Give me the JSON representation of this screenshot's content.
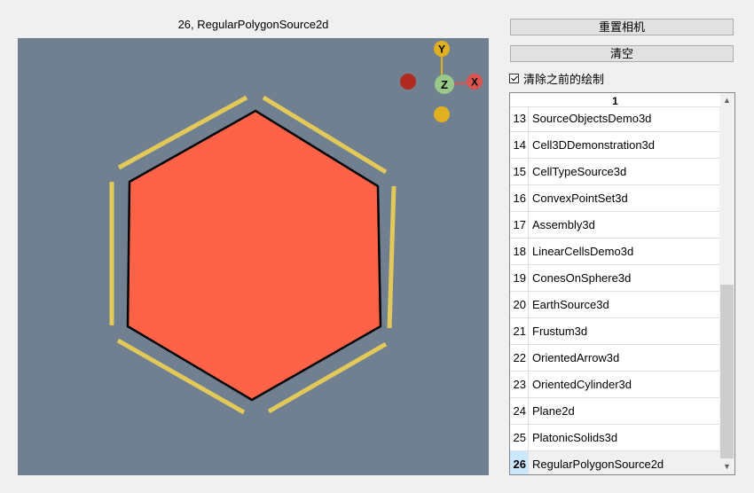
{
  "window": {
    "title": "26, RegularPolygonSource2d"
  },
  "controls": {
    "reset_camera_label": "重置相机",
    "clear_label": "清空",
    "clear_previous_label": "清除之前的绘制",
    "clear_previous_checked": true
  },
  "viewport": {
    "background_color": "#708090",
    "polygon_fill": "#FF6347",
    "outline_color": "#E3C95A",
    "axes": {
      "x_label": "X",
      "y_label": "Y",
      "z_label": "Z"
    }
  },
  "list": {
    "header": "1",
    "items": [
      {
        "num": "13",
        "name": "SourceObjectsDemo3d"
      },
      {
        "num": "14",
        "name": "Cell3DDemonstration3d"
      },
      {
        "num": "15",
        "name": "CellTypeSource3d"
      },
      {
        "num": "16",
        "name": "ConvexPointSet3d"
      },
      {
        "num": "17",
        "name": "Assembly3d"
      },
      {
        "num": "18",
        "name": "LinearCellsDemo3d"
      },
      {
        "num": "19",
        "name": "ConesOnSphere3d"
      },
      {
        "num": "20",
        "name": "EarthSource3d"
      },
      {
        "num": "21",
        "name": "Frustum3d"
      },
      {
        "num": "22",
        "name": "OrientedArrow3d"
      },
      {
        "num": "23",
        "name": "OrientedCylinder3d"
      },
      {
        "num": "24",
        "name": "Plane2d"
      },
      {
        "num": "25",
        "name": "PlatonicSolids3d"
      },
      {
        "num": "26",
        "name": "RegularPolygonSource2d"
      }
    ],
    "selected_num": "26"
  }
}
